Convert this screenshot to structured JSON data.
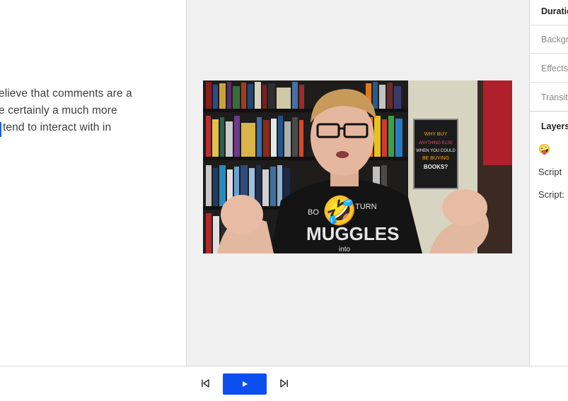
{
  "script": {
    "lines": [
      "elieve that comments are a",
      "e certainly a much more",
      "tend to interact with in"
    ]
  },
  "preview": {
    "emoji": "🤣",
    "shirt_text": [
      "BO",
      "TURN",
      "MUGGLES",
      "into"
    ],
    "poster_text": [
      "WHY BUY",
      "ANYTHING ELSE",
      "WHEN YOU COULD",
      "BE BUYING",
      "BOOKS?"
    ]
  },
  "properties": {
    "tabs": [
      "Duration",
      "Background",
      "Effects",
      "Transitions"
    ],
    "layers_title": "Layers",
    "layers": [
      "🤪",
      "Script",
      "Script:"
    ]
  },
  "transport": {
    "prev_icon": "skip-previous-icon",
    "play_icon": "play-icon",
    "next_icon": "skip-next-icon"
  },
  "colors": {
    "accent": "#0b4ff0",
    "caret": "#1f5fd6",
    "canvas_bg": "#f0f0f0"
  }
}
